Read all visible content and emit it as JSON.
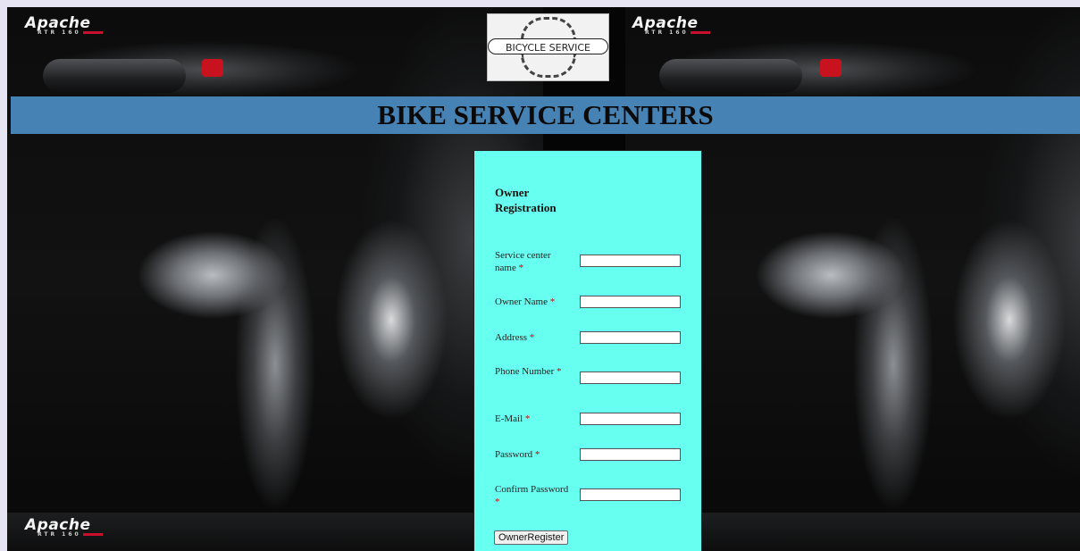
{
  "brand": {
    "name": "Apache",
    "model": "RTR 160"
  },
  "logo": {
    "text": "BICYCLE SERVICE"
  },
  "banner": {
    "title": "BIKE SERVICE CENTERS"
  },
  "form": {
    "title": "Owner Registration",
    "required_marker": "*",
    "fields": [
      {
        "label": "Service center name",
        "value": ""
      },
      {
        "label": "Owner Name",
        "value": ""
      },
      {
        "label": "Address",
        "value": ""
      },
      {
        "label": "Phone Number",
        "value": ""
      },
      {
        "label": "E-Mail",
        "value": ""
      },
      {
        "label": "Password",
        "value": ""
      },
      {
        "label": "Confirm Password",
        "value": ""
      }
    ],
    "submit_label": "OwnerRegister"
  },
  "colors": {
    "banner": "#4682b4",
    "form_bg": "#66fff0",
    "required": "#d10000",
    "page_bg": "#e6e3f2"
  }
}
